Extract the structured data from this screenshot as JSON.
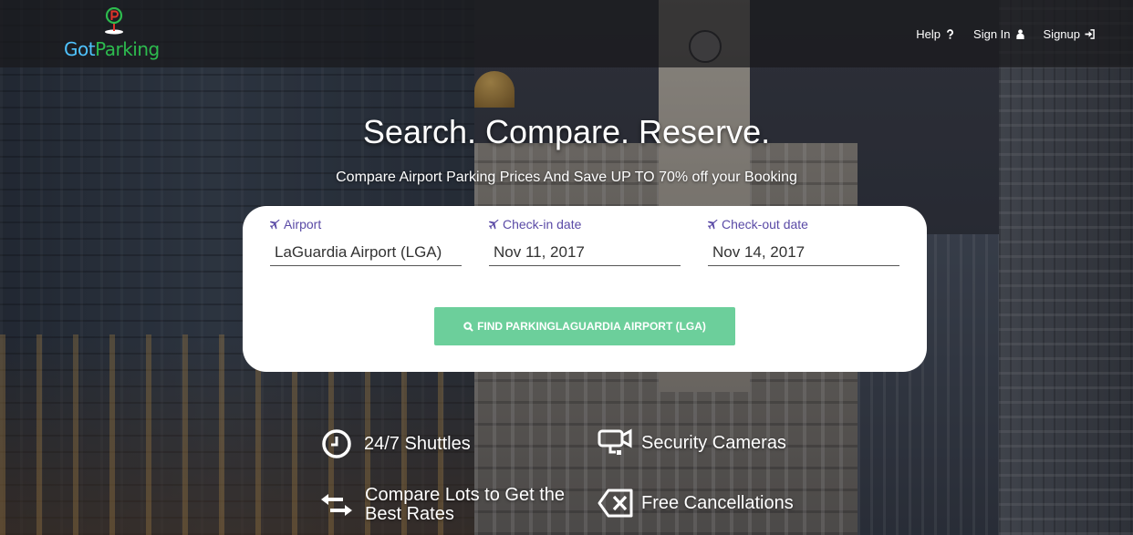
{
  "header": {
    "logo": {
      "got": "Got",
      "parking": "Parking"
    },
    "nav": [
      {
        "label": "Help",
        "icon": "question-icon"
      },
      {
        "label": "Sign In",
        "icon": "user-icon"
      },
      {
        "label": "Signup",
        "icon": "sign-in-icon"
      }
    ]
  },
  "hero": {
    "title": "Search. Compare. Reserve.",
    "subtitle": "Compare Airport Parking Prices And Save UP TO 70% off your Booking"
  },
  "search": {
    "airport": {
      "label": "Airport",
      "value": "LaGuardia Airport (LGA)",
      "icon": "plane-icon"
    },
    "checkin": {
      "label": "Check-in date",
      "value": "Nov 11, 2017",
      "icon": "plane-icon"
    },
    "checkout": {
      "label": "Check-out date",
      "value": "Nov 14, 2017",
      "icon": "plane-icon"
    },
    "button_label": "FIND PARKINGLAGUARDIA AIRPORT (LGA)",
    "button_icon": "search-icon"
  },
  "features": [
    {
      "label": "24/7 Shuttles",
      "icon": "clock-icon"
    },
    {
      "label": "Security Cameras",
      "icon": "camera-icon"
    },
    {
      "label": "Compare Lots to Get the Best Rates",
      "icon": "exchange-icon"
    },
    {
      "label": "Free Cancellations",
      "icon": "delete-icon"
    }
  ],
  "colors": {
    "accent_purple": "#5a4aa6",
    "button_green": "#6ccf9b",
    "logo_blue": "#4fc3ff",
    "logo_green": "#2dbb4e"
  }
}
